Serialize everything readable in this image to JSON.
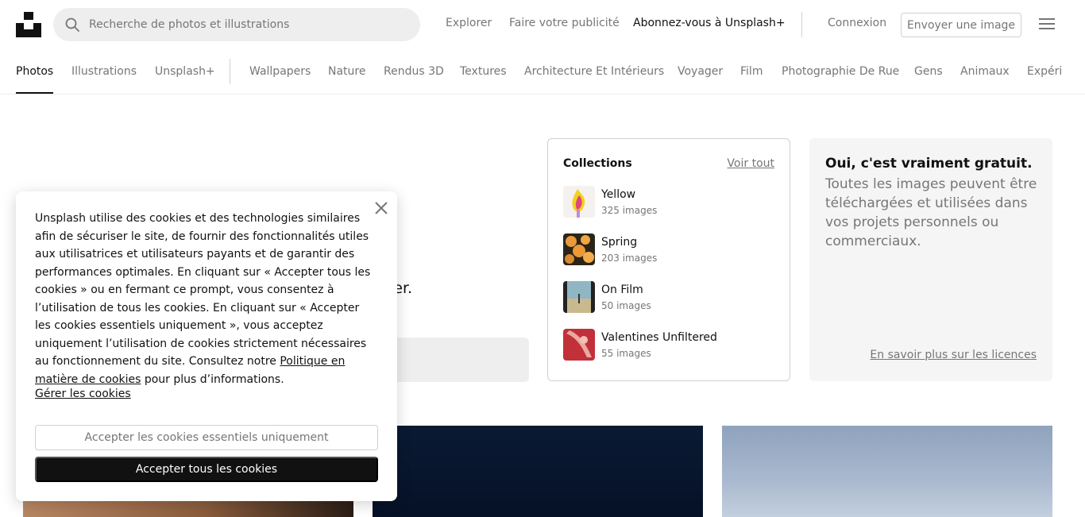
{
  "header": {
    "search_placeholder": "Recherche de photos et illustrations",
    "nav": {
      "explore": "Explorer",
      "advertise": "Faire votre publicité",
      "subscribe": "Abonnez-vous à Unsplash+",
      "login": "Connexion",
      "submit": "Envoyer une image"
    }
  },
  "categories": {
    "photos": "Photos",
    "illustrations": "Illustrations",
    "plus": "Unsplash+",
    "items": [
      "Wallpapers",
      "Nature",
      "Rendus 3D",
      "Textures",
      "Architecture Et Intérieurs",
      "Voyager",
      "Film",
      "Photographie De Rue",
      "Gens",
      "Animaux",
      "Expéri"
    ]
  },
  "hero": {
    "tail_text": "ier."
  },
  "collections": {
    "title": "Collections",
    "see_all": "Voir tout",
    "items": [
      {
        "name": "Yellow",
        "count": "325 images"
      },
      {
        "name": "Spring",
        "count": "203 images"
      },
      {
        "name": "On Film",
        "count": "50 images"
      },
      {
        "name": "Valentines Unfiltered",
        "count": "55 images"
      }
    ]
  },
  "license": {
    "title": "Oui, c'est vraiment gratuit.",
    "text": "Toutes les images peuvent être téléchargées et utilisées dans vos projets personnels ou commerciaux.",
    "link": "En savoir plus sur les licences"
  },
  "cookie": {
    "text_before_link": "Unsplash utilise des cookies et des technologies similaires afin de sécuriser le site, de fournir des fonctionnalités utiles aux utilisatrices et utilisateurs payants et de garantir des performances optimales. En cliquant sur « Accepter tous les cookies » ou en fermant ce prompt, vous consentez à l’utilisation de tous les cookies. En cliquant sur « Accepter les cookies essentiels uniquement », vous acceptez uniquement l’utilisation de cookies strictement nécessaires au fonctionnement du site. Consultez notre",
    "policy_link": "Politique en matière de cookies",
    "text_after_link": "pour plus d’informations.",
    "manage": "Gérer les cookies",
    "essential_button": "Accepter les cookies essentiels uniquement",
    "accept_all_button": "Accepter tous les cookies"
  },
  "icons": {
    "logo": "unsplash-logo",
    "search": "search-icon",
    "menu": "hamburger-menu-icon",
    "close": "close-icon"
  }
}
